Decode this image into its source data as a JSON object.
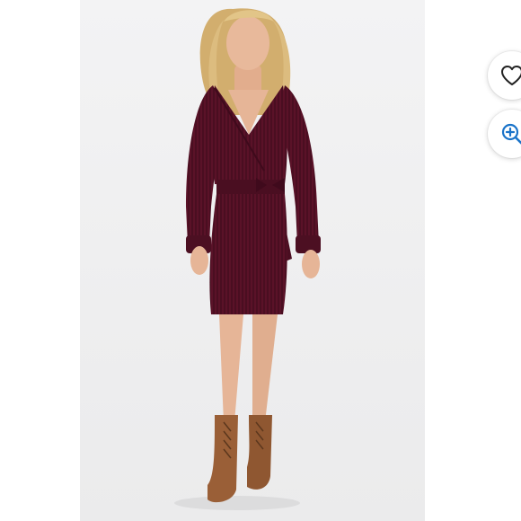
{
  "product_image": {
    "alt_description": "",
    "colors": {
      "background": "#efeff0",
      "dress": "#5a1228",
      "dress_shadow": "#3f0a1c",
      "skin": "#e6b597",
      "hair": "#d9b778",
      "boots": "#9a5f37"
    }
  },
  "actions": {
    "like": {
      "icon": "heart-icon",
      "label": ""
    },
    "zoom": {
      "icon": "zoom-in-icon",
      "label": ""
    }
  },
  "accent_color": "#1a73c9"
}
